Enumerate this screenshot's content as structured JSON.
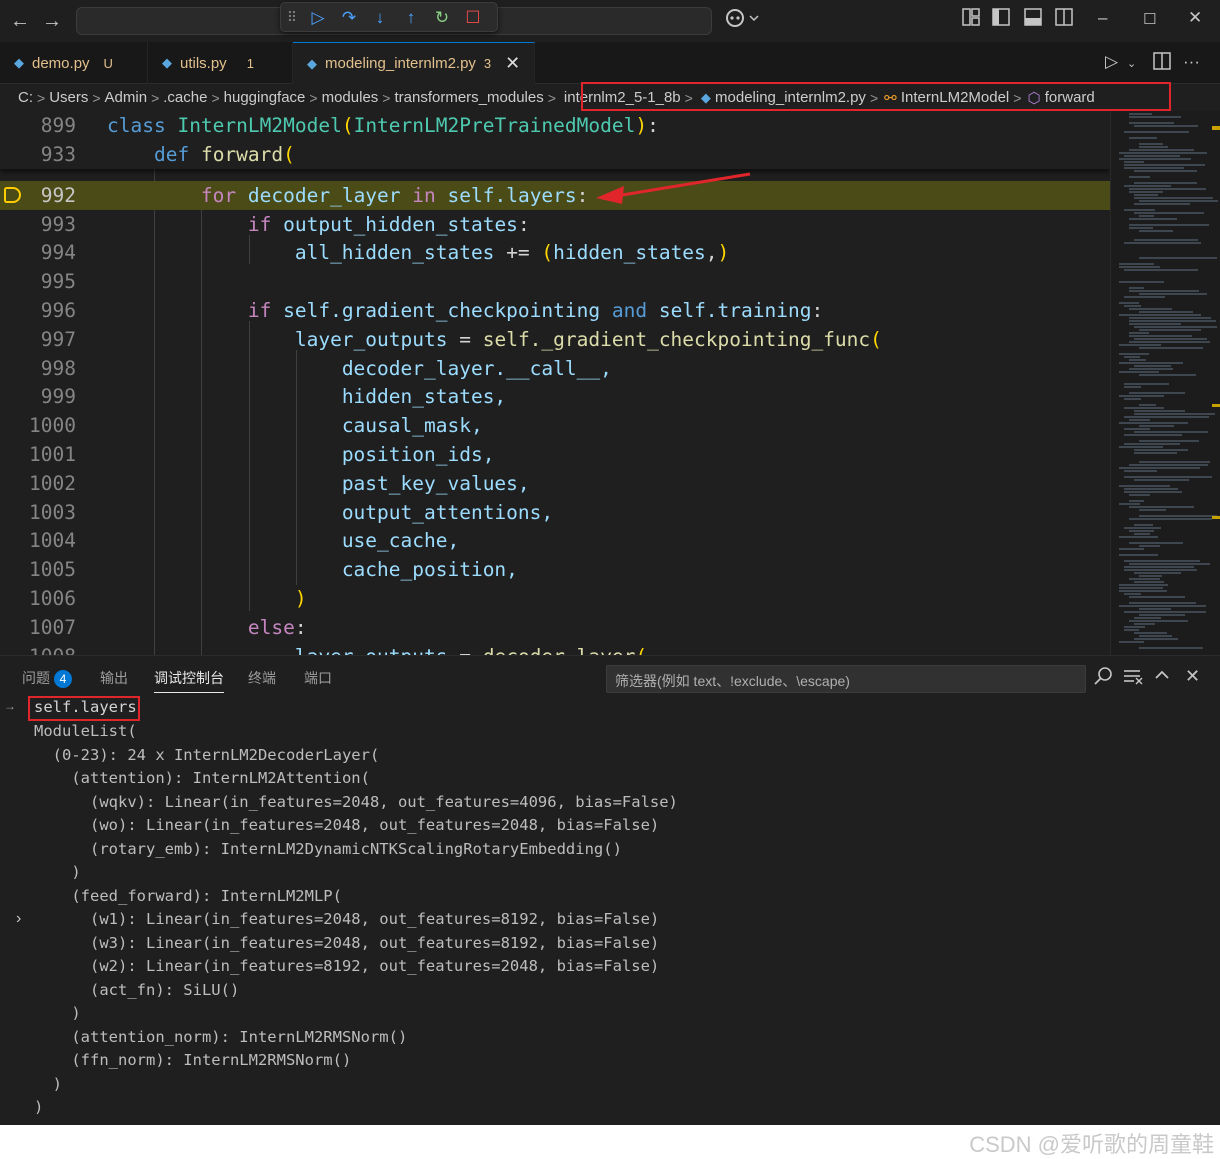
{
  "titlebar": {
    "back": "←",
    "forward": "→",
    "right_icons": [
      "layout-icon",
      "toggle-sidebar-icon",
      "toggle-panel-icon",
      "toggle-secondary-icon"
    ],
    "minimize": "–",
    "maximize": "☐",
    "close": "✕"
  },
  "debug_toolbar": {
    "grip": "⠿",
    "continue": "▷",
    "step_over": "↷",
    "step_into": "↓",
    "step_out": "↑",
    "restart": "↻",
    "stop": "☐"
  },
  "tabs": [
    {
      "name": "demo.py",
      "flag": "U"
    },
    {
      "name": "utils.py",
      "flag": "1"
    },
    {
      "name": "modeling_internlm2.py",
      "flag": "3",
      "close": "✕"
    }
  ],
  "breadcrumb": [
    "C:",
    "Users",
    "Admin",
    ".cache",
    "huggingface",
    "modules",
    "transformers_modules",
    "internlm2_5-1_8b",
    "modeling_internlm2.py",
    "InternLM2Model",
    "forward"
  ],
  "editor": {
    "sticky": [
      {
        "ln": "899"
      },
      {
        "ln": "933"
      }
    ],
    "lines": [
      "992",
      "993",
      "994",
      "995",
      "996",
      "997",
      "998",
      "999",
      "1000",
      "1001",
      "1002",
      "1003",
      "1004",
      "1005",
      "1006",
      "1007",
      "1008"
    ],
    "tokens": {
      "class_kw": "class",
      "class_name": "InternLM2Model",
      "base_name": "InternLM2PreTrainedModel",
      "def_kw": "def",
      "forward_fn": "forward",
      "for_kw": "for",
      "decoder_layer": "decoder_layer",
      "in_kw": "in",
      "self_layers": "self.layers",
      "if_kw": "if",
      "output_hidden_states": "output_hidden_states",
      "all_hidden_states": "all_hidden_states",
      "plus_eq": "+=",
      "hidden_states": "hidden_states",
      "gc_attr": "self.gradient_checkpointing",
      "and_kw": "and",
      "training": "self.training",
      "layer_outputs": "layer_outputs",
      "gc_func": "self._gradient_checkpointing_func",
      "call": "decoder_layer.__call__,",
      "hs": "hidden_states,",
      "causal_mask": "causal_mask,",
      "position_ids": "position_ids,",
      "past_key_values": "past_key_values,",
      "output_attentions": "output_attentions,",
      "use_cache": "use_cache,",
      "cache_position": "cache_position,",
      "else_kw": "else",
      "decoder_call": "decoder_layer"
    }
  },
  "panel": {
    "tabs": [
      {
        "label": "问题",
        "badge": "4"
      },
      {
        "label": "输出"
      },
      {
        "label": "调试控制台"
      },
      {
        "label": "终端"
      },
      {
        "label": "端口"
      }
    ],
    "filter_placeholder": "筛选器(例如 text、!exclude、\\escape)",
    "output": [
      "self.layers",
      "ModuleList(",
      "  (0-23): 24 x InternLM2DecoderLayer(",
      "    (attention): InternLM2Attention(",
      "      (wqkv): Linear(in_features=2048, out_features=4096, bias=False)",
      "      (wo): Linear(in_features=2048, out_features=2048, bias=False)",
      "      (rotary_emb): InternLM2DynamicNTKScalingRotaryEmbedding()",
      "    )",
      "    (feed_forward): InternLM2MLP(",
      "      (w1): Linear(in_features=2048, out_features=8192, bias=False)",
      "      (w3): Linear(in_features=2048, out_features=8192, bias=False)",
      "      (w2): Linear(in_features=8192, out_features=2048, bias=False)",
      "      (act_fn): SiLU()",
      "    )",
      "    (attention_norm): InternLM2RMSNorm()",
      "    (ffn_norm): InternLM2RMSNorm()",
      "  )",
      ")"
    ]
  },
  "watermark": "CSDN @爱听歌的周童鞋",
  "colors": {
    "accent": "#0078d4",
    "highlight": "#e0262b",
    "current_line": "#4b4b18"
  }
}
